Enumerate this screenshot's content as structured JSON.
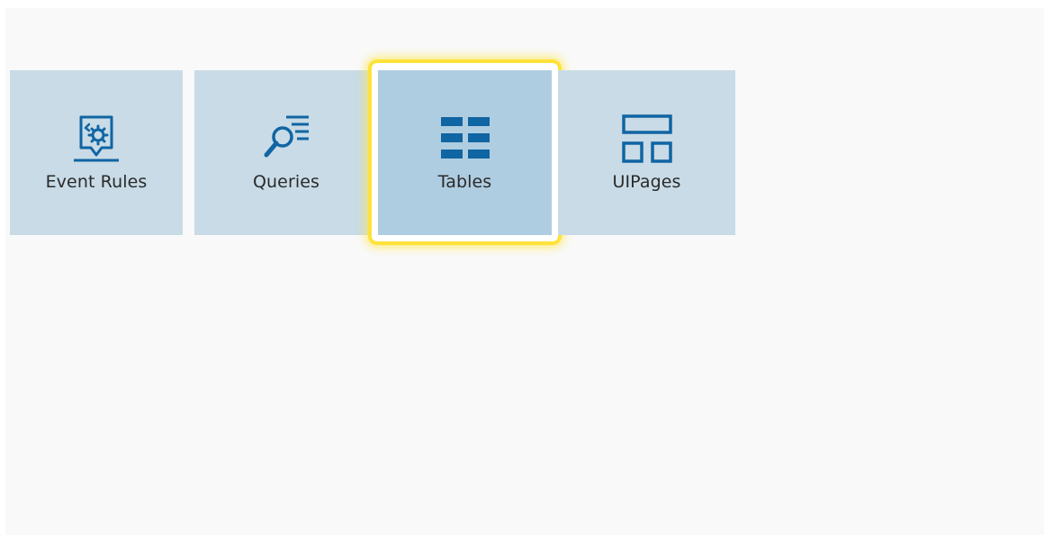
{
  "tiles": [
    {
      "label": "Event Rules",
      "icon": "event-rules-icon"
    },
    {
      "label": "Queries",
      "icon": "queries-icon"
    },
    {
      "label": "Tables",
      "icon": "tables-icon",
      "selected": true
    },
    {
      "label": "UIPages",
      "icon": "uipages-icon"
    }
  ],
  "colors": {
    "tile_bg": "#c8dbe6",
    "tile_selected_bg": "#afcde0",
    "icon": "#1065a3",
    "focus_ring": "#ffe23a",
    "page_bg": "#f9f9f9"
  }
}
